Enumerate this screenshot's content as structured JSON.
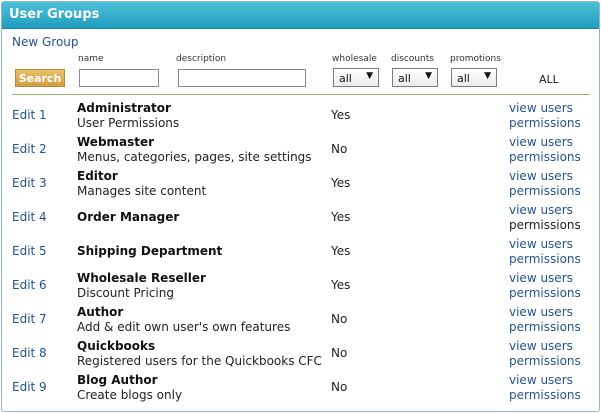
{
  "panel": {
    "title": "User Groups"
  },
  "actions": {
    "new_group": "New Group",
    "search": "Search"
  },
  "filters": {
    "name_label": "name",
    "description_label": "description",
    "wholesale_label": "wholesale",
    "discounts_label": "discounts",
    "promotions_label": "promotions",
    "name_value": "",
    "description_value": "",
    "wholesale_value": "all",
    "discounts_value": "all",
    "promotions_value": "all",
    "all_label": "ALL"
  },
  "rows": [
    {
      "edit": "Edit 1",
      "name": "Administrator",
      "description": "User Permissions",
      "wholesale": "Yes",
      "view_users": "view users",
      "permissions": "permissions"
    },
    {
      "edit": "Edit 2",
      "name": "Webmaster",
      "description": "Menus, categories, pages, site settings",
      "wholesale": "No",
      "view_users": "view users",
      "permissions": "permissions"
    },
    {
      "edit": "Edit 3",
      "name": "Editor",
      "description": "Manages site content",
      "wholesale": "Yes",
      "view_users": "view users",
      "permissions": "permissions"
    },
    {
      "edit": "Edit 4",
      "name": "Order Manager",
      "description": "",
      "wholesale": "Yes",
      "view_users": "view users",
      "permissions": "permissions"
    },
    {
      "edit": "Edit 5",
      "name": "Shipping Department",
      "description": "",
      "wholesale": "Yes",
      "view_users": "view users",
      "permissions": "permissions"
    },
    {
      "edit": "Edit 6",
      "name": "Wholesale Reseller",
      "description": "Discount Pricing",
      "wholesale": "Yes",
      "view_users": "view users",
      "permissions": "permissions"
    },
    {
      "edit": "Edit 7",
      "name": "Author",
      "description": "Add & edit own user's own features",
      "wholesale": "No",
      "view_users": "view users",
      "permissions": "permissions"
    },
    {
      "edit": "Edit 8",
      "name": "Quickbooks",
      "description": "Registered users for the Quickbooks CFC",
      "wholesale": "No",
      "view_users": "view users",
      "permissions": "permissions"
    },
    {
      "edit": "Edit 9",
      "name": "Blog Author",
      "description": "Create blogs only",
      "wholesale": "No",
      "view_users": "view users",
      "permissions": "permissions"
    }
  ]
}
